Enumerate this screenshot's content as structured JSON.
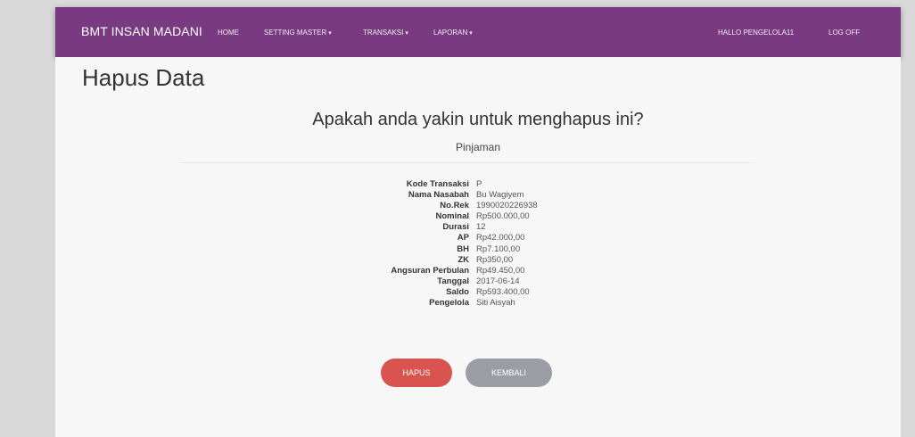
{
  "navbar": {
    "brand": "BMT INSAN MADANI",
    "home": "HOME",
    "setting_master": "SETTING MASTER",
    "transaksi": "TRANSAKSI",
    "laporan": "LAPORAN",
    "greeting": "HALLO PENGELOLA11",
    "logoff": "LOG OFF"
  },
  "page": {
    "title": "Hapus Data",
    "question": "Apakah anda yakin untuk menghapus ini?",
    "subtitle": "Pinjaman"
  },
  "details": [
    {
      "label": "Kode Transaksi",
      "value": "P"
    },
    {
      "label": "Nama Nasabah",
      "value": "Bu Wagiyem"
    },
    {
      "label": "No.Rek",
      "value": "1990020226938"
    },
    {
      "label": "Nominal",
      "value": "Rp500.000,00"
    },
    {
      "label": "Durasi",
      "value": "12"
    },
    {
      "label": "AP",
      "value": "Rp42.000,00"
    },
    {
      "label": "BH",
      "value": "Rp7.100,00"
    },
    {
      "label": "ZK",
      "value": "Rp350,00"
    },
    {
      "label": "Angsuran Perbulan",
      "value": "Rp49.450,00"
    },
    {
      "label": "Tanggal",
      "value": "2017-06-14"
    },
    {
      "label": "Saldo",
      "value": "Rp593.400,00"
    },
    {
      "label": "Pengelola",
      "value": "Siti Aisyah"
    }
  ],
  "buttons": {
    "hapus": "HAPUS",
    "kembali": "KEMBALI"
  },
  "colors": {
    "navbar": "#7a3a82",
    "hapus": "#d9534f",
    "kembali": "#9a9ea4"
  }
}
